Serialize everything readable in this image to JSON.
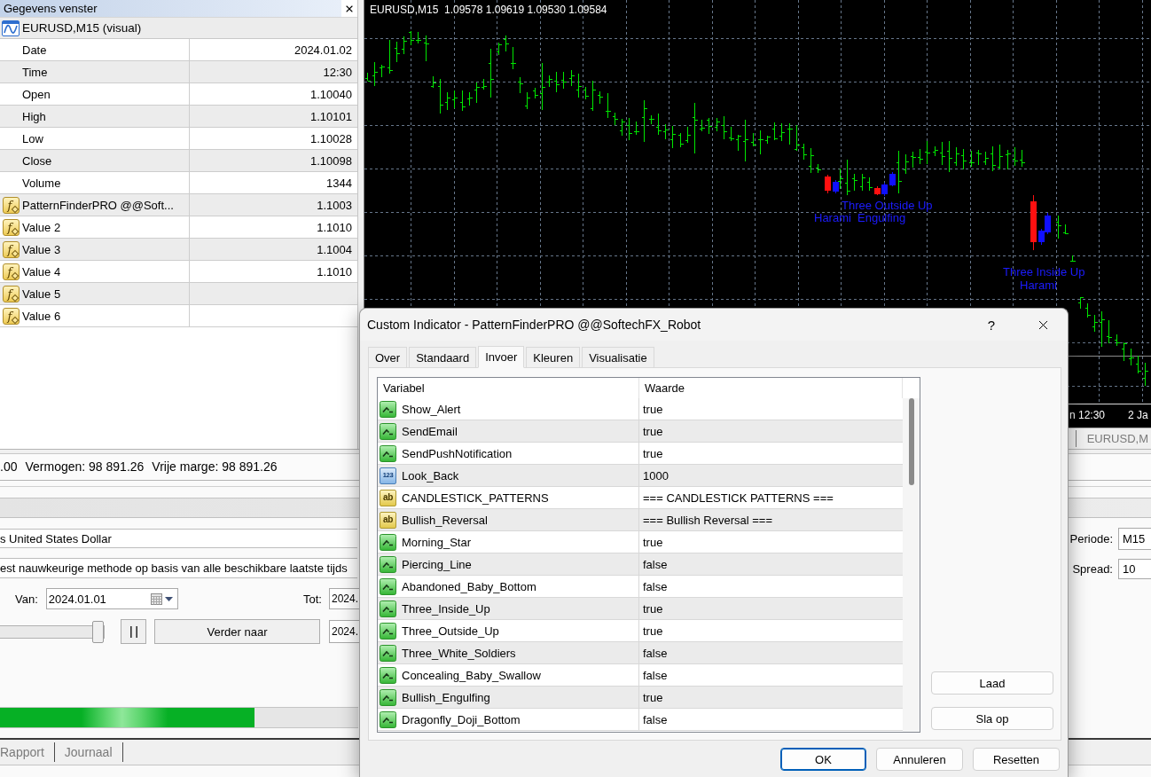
{
  "data_window": {
    "title": "Gegevens venster",
    "symbol": "EURUSD,M15 (visual)",
    "rows": [
      {
        "kind": "field",
        "label": "Date",
        "value": "2024.01.02"
      },
      {
        "kind": "field",
        "label": "Time",
        "value": "12:30"
      },
      {
        "kind": "field",
        "label": "Open",
        "value": "1.10040"
      },
      {
        "kind": "field",
        "label": "High",
        "value": "1.10101"
      },
      {
        "kind": "field",
        "label": "Low",
        "value": "1.10028"
      },
      {
        "kind": "field",
        "label": "Close",
        "value": "1.10098"
      },
      {
        "kind": "field",
        "label": "Volume",
        "value": "1344"
      },
      {
        "kind": "indicator",
        "icon_text": "f",
        "label": "PatternFinderPRO @@Soft...",
        "value": "1.1003"
      },
      {
        "kind": "indicator",
        "icon_text": "f",
        "label": "Value 2",
        "value": "1.1010"
      },
      {
        "kind": "indicator",
        "icon_text": "f",
        "label": "Value 3",
        "value": "1.1004"
      },
      {
        "kind": "indicator",
        "icon_text": "f",
        "label": "Value 4",
        "value": "1.1010"
      },
      {
        "kind": "indicator",
        "icon_text": "f",
        "label": "Value 5"
      },
      {
        "kind": "indicator",
        "icon_text": "f",
        "label": "Value 6"
      }
    ]
  },
  "chart": {
    "header": "EURUSD,M15  1.09578 1.09619 1.09530 1.09584",
    "pattern_labels": [
      "Three Outside Up",
      "Harami",
      "Engulfing",
      "Three Inside Up",
      "Harami"
    ],
    "time_labels": [
      "n 12:30",
      "2 Ja"
    ],
    "tabs": [
      {
        "label": "EURUSD,M",
        "selected": false
      }
    ]
  },
  "account_bar": [
    ".00",
    "Vermogen: 98 891.26",
    "Vrije marge: 98 891.26"
  ],
  "tester": {
    "symbol": "s United States Dollar",
    "model": "est nauwkeurige methode op basis van alle beschikbare laatste tijds",
    "from_label": "Van:",
    "from_value": "2024.01.01",
    "to_label": "Tot:",
    "to_value": "2024.",
    "speed_slider": {
      "level": 1
    },
    "skip_button": "Verder naar",
    "skip_value": "2024.",
    "period_label": "Periode:",
    "period_value": "M15",
    "spread_label": "Spread:",
    "spread_value": "10",
    "progress": {
      "level": 0.71
    },
    "tabs": [
      {
        "label": "Rapport",
        "selected": false
      },
      {
        "label": "Journaal",
        "selected": false
      }
    ]
  },
  "dialog": {
    "title": "Custom Indicator - PatternFinderPRO @@SoftechFX_Robot",
    "help_button": "?",
    "tabs": [
      {
        "label": "Over",
        "selected": false
      },
      {
        "label": "Standaard",
        "selected": false
      },
      {
        "label": "Invoer",
        "selected": true
      },
      {
        "label": "Kleuren",
        "selected": false
      },
      {
        "label": "Visualisatie",
        "selected": false
      }
    ],
    "columns": [
      "Variabel",
      "Waarde"
    ],
    "rows": [
      {
        "kind": "bool",
        "name": "Show_Alert",
        "value": "true"
      },
      {
        "kind": "bool",
        "name": "SendEmail",
        "value": "true"
      },
      {
        "kind": "bool",
        "name": "SendPushNotification",
        "value": "true"
      },
      {
        "kind": "int",
        "badge": "123",
        "name": "Look_Back",
        "value": "1000"
      },
      {
        "kind": "string",
        "badge": "ab",
        "name": "CANDLESTICK_PATTERNS",
        "value": "=== CANDLESTICK PATTERNS ==="
      },
      {
        "kind": "string",
        "badge": "ab",
        "name": "Bullish_Reversal",
        "value": "=== Bullish Reversal ==="
      },
      {
        "kind": "bool",
        "name": "Morning_Star",
        "value": "true"
      },
      {
        "kind": "bool",
        "name": "Piercing_Line",
        "value": "false"
      },
      {
        "kind": "bool",
        "name": "Abandoned_Baby_Bottom",
        "value": "false"
      },
      {
        "kind": "bool",
        "name": "Three_Inside_Up",
        "value": "true"
      },
      {
        "kind": "bool",
        "name": "Three_Outside_Up",
        "value": "true"
      },
      {
        "kind": "bool",
        "name": "Three_White_Soldiers",
        "value": "false"
      },
      {
        "kind": "bool",
        "name": "Concealing_Baby_Swallow",
        "value": "false"
      },
      {
        "kind": "bool",
        "name": "Bullish_Engulfing",
        "value": "true"
      },
      {
        "kind": "bool",
        "name": "Dragonfly_Doji_Bottom",
        "value": "false"
      }
    ],
    "side_buttons": [
      "Laad",
      "Sla op"
    ],
    "buttons": [
      {
        "label": "OK",
        "default": true
      },
      {
        "label": "Annuleren",
        "default": false
      },
      {
        "label": "Resetten",
        "default": false
      }
    ]
  }
}
